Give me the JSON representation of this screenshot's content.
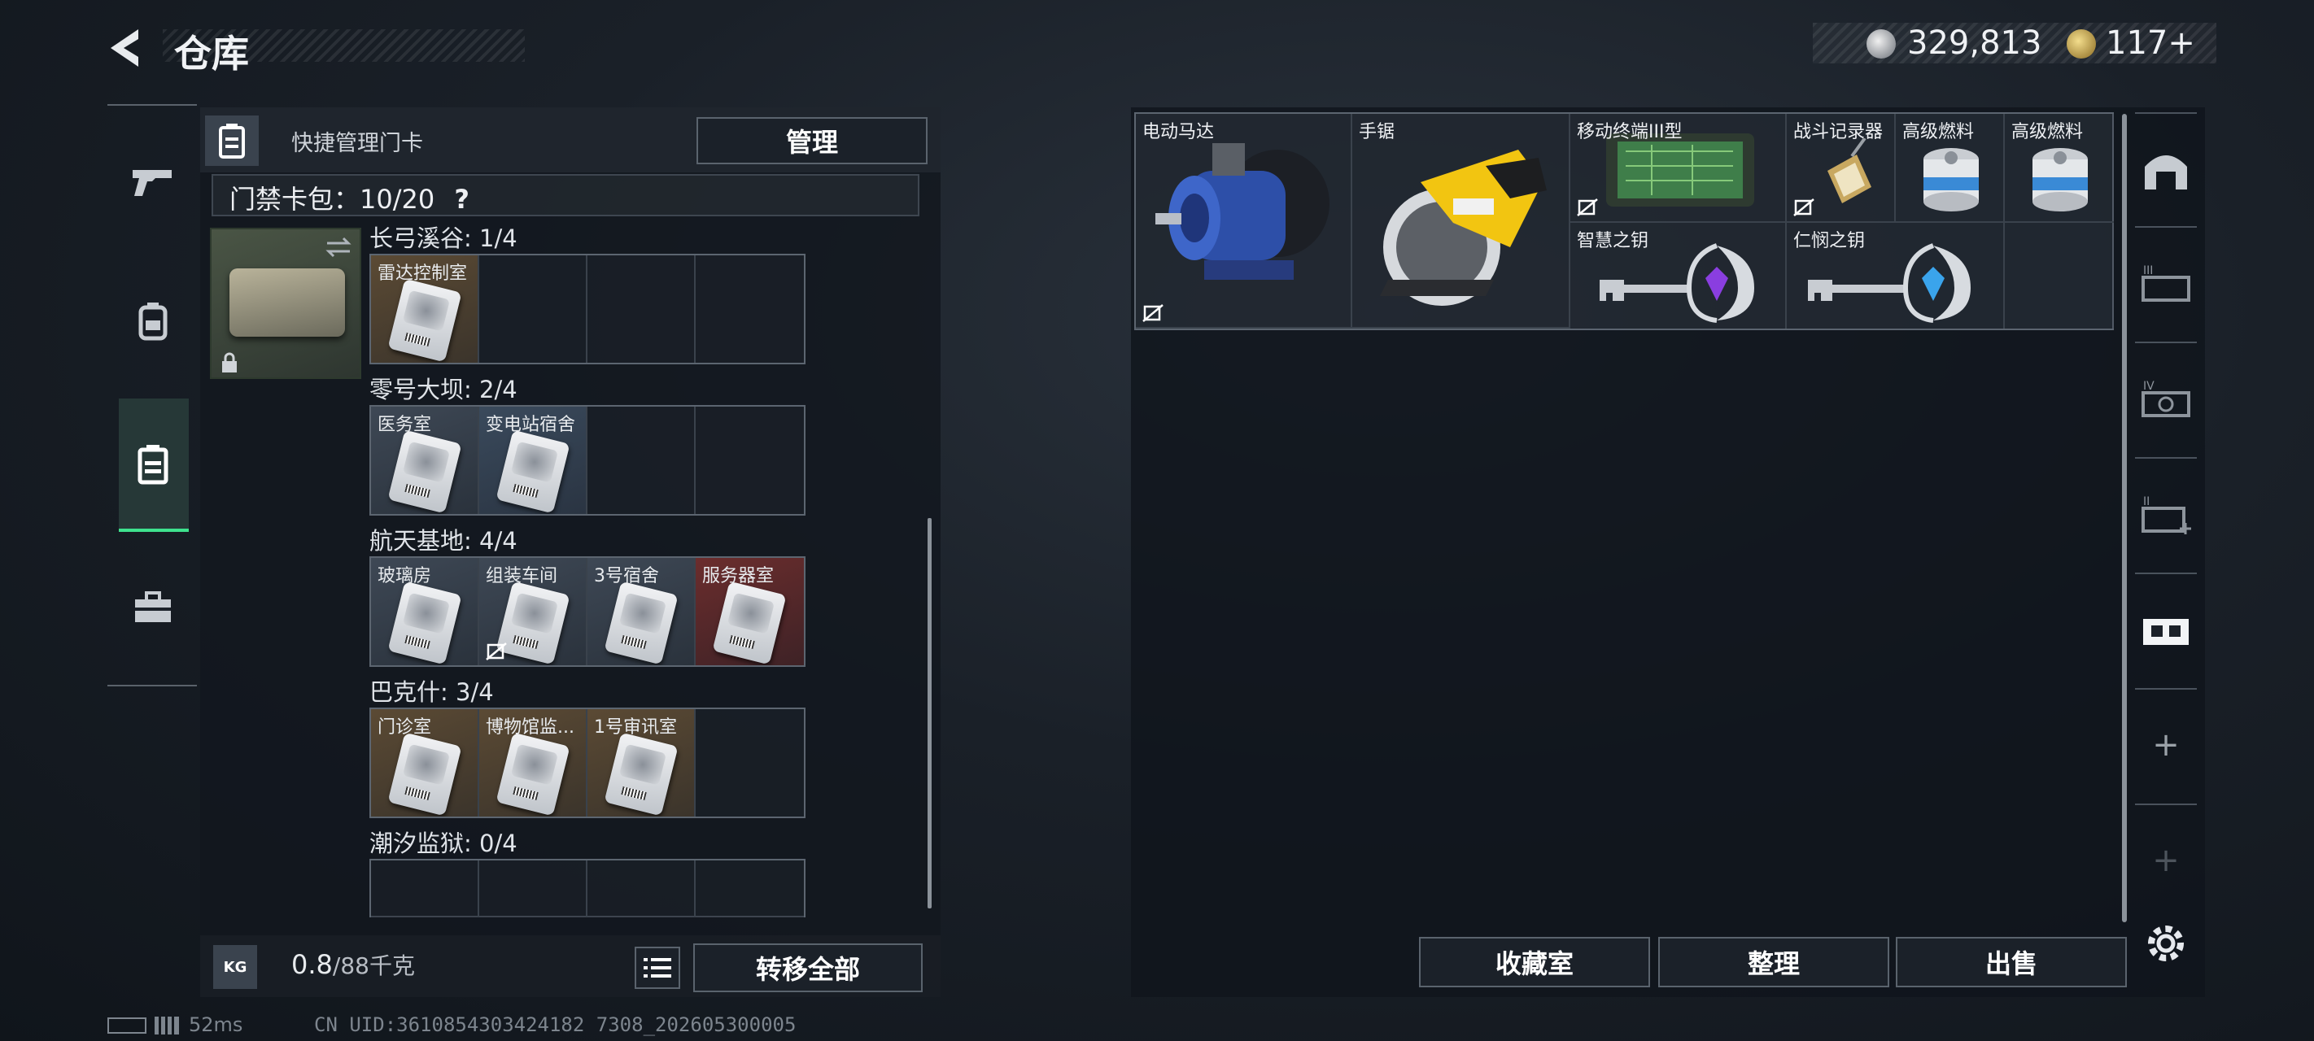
{
  "header": {
    "title": "仓库",
    "currency": [
      {
        "icon": "silver-coin-icon",
        "value": "329,813"
      },
      {
        "icon": "gold-coin-icon",
        "value": "117+"
      }
    ]
  },
  "nav": {
    "items": [
      {
        "icon": "pistol-icon"
      },
      {
        "icon": "backpack-icon"
      },
      {
        "icon": "keycard-wallet-icon",
        "active": true
      },
      {
        "icon": "toolbox-icon"
      }
    ],
    "active_color": "#3ee28e"
  },
  "keycards": {
    "header_label": "快捷管理门卡",
    "manage_label": "管理",
    "capacity_label": "门禁卡包：",
    "capacity_value": "10/20",
    "help": "?",
    "regions": [
      {
        "title": "长弓溪谷: 1/4",
        "cards": [
          {
            "name": "雷达控制室",
            "color": "orange"
          },
          null,
          null,
          null
        ]
      },
      {
        "title": "零号大坝: 2/4",
        "cards": [
          {
            "name": "医务室",
            "color": "grey"
          },
          {
            "name": "变电站宿舍",
            "color": "blue"
          },
          null,
          null
        ]
      },
      {
        "title": "航天基地: 4/4",
        "cards": [
          {
            "name": "玻璃房",
            "color": "grey"
          },
          {
            "name": "组装车间",
            "color": "grey",
            "untradeable": true
          },
          {
            "name": "3号宿舍",
            "color": "grey"
          },
          {
            "name": "服务器室",
            "color": "red"
          }
        ]
      },
      {
        "title": "巴克什: 3/4",
        "cards": [
          {
            "name": "门诊室",
            "color": "orange"
          },
          {
            "name": "博物馆监...",
            "color": "orange"
          },
          {
            "name": "1号审讯室",
            "color": "orange"
          },
          null
        ]
      },
      {
        "title": "潮汐监狱: 0/4",
        "cards": [
          null,
          null,
          null,
          null
        ]
      }
    ],
    "weight_value": "0.8",
    "weight_max": "/88千克",
    "kg_label": "KG",
    "transfer_all_label": "转移全部"
  },
  "stash": {
    "items": [
      {
        "name": "电动马达",
        "icon": "electric-motor-icon",
        "untradeable": true
      },
      {
        "name": "手锯",
        "icon": "circular-saw-icon"
      },
      {
        "name": "移动终端III型",
        "icon": "mobile-terminal-icon",
        "untradeable": true
      },
      {
        "name": "战斗记录器",
        "icon": "combat-recorder-icon",
        "untradeable": true
      },
      {
        "name": "高级燃料",
        "icon": "fuel-can-icon"
      },
      {
        "name": "高级燃料",
        "icon": "fuel-can-icon"
      },
      {
        "name": "智慧之钥",
        "icon": "purple-key-icon"
      },
      {
        "name": "仁悯之钥",
        "icon": "blue-key-icon"
      }
    ],
    "buttons": {
      "collection": "收藏室",
      "sort": "整理",
      "sell": "出售"
    }
  },
  "rail": {
    "items": [
      {
        "icon": "vault-icon"
      },
      {
        "icon": "stash-page-iii-icon",
        "label": "III"
      },
      {
        "icon": "stash-page-iv-icon",
        "label": "IV"
      },
      {
        "icon": "stash-page-ii-icon",
        "label": "II"
      },
      {
        "icon": "stash-page-active-icon"
      },
      {
        "icon": "add-icon",
        "label": "+"
      },
      {
        "icon": "add-disabled-icon",
        "label": "+"
      }
    ],
    "settings_icon": "gear-icon"
  },
  "status": {
    "ping": "52ms",
    "uid": "CN UID:3610854303424182 7308_202605300005"
  }
}
